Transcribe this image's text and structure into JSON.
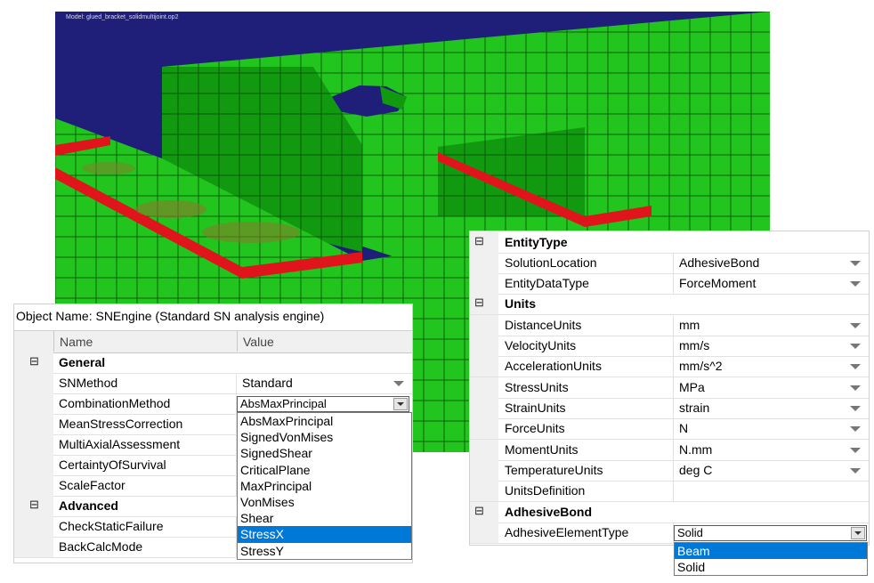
{
  "viewport": {
    "model_label": "Model:    glued_bracket_solidmultijoint.op2",
    "colors": {
      "background": "#1f1f7a",
      "mesh_green": "#22c41e",
      "mesh_dark": "#119910",
      "bond_red": "#e0141b",
      "mesh_line": "#0a4a08"
    }
  },
  "left_panel": {
    "object_name": "Object Name: SNEngine (Standard SN analysis engine)",
    "columns": {
      "name": "Name",
      "value": "Value"
    },
    "sections": [
      {
        "label": "General",
        "expander": "⊟",
        "properties": [
          {
            "name": "SNMethod",
            "value": "Standard",
            "dropdown": true
          },
          {
            "name": "CombinationMethod",
            "value": "AbsMaxPrincipal",
            "dropdown": true,
            "open": true
          },
          {
            "name": "MeanStressCorrection",
            "value": ""
          },
          {
            "name": "MultiAxialAssessment",
            "value": ""
          },
          {
            "name": "CertaintyOfSurvival",
            "value": ""
          },
          {
            "name": "ScaleFactor",
            "value": ""
          }
        ]
      },
      {
        "label": "Advanced",
        "expander": "⊟",
        "properties": [
          {
            "name": "CheckStaticFailure",
            "value": ""
          },
          {
            "name": "BackCalcMode",
            "value": ""
          }
        ]
      }
    ],
    "combination_options": [
      "AbsMaxPrincipal",
      "SignedVonMises",
      "SignedShear",
      "CriticalPlane",
      "MaxPrincipal",
      "VonMises",
      "Shear",
      "StressX",
      "StressY"
    ],
    "highlighted_option": "StressX"
  },
  "right_panel": {
    "sections": [
      {
        "label": "EntityType",
        "expander": "⊟",
        "properties": [
          {
            "name": "SolutionLocation",
            "value": "AdhesiveBond",
            "dropdown": true
          },
          {
            "name": "EntityDataType",
            "value": "ForceMoment",
            "dropdown": true
          }
        ]
      },
      {
        "label": "Units",
        "expander": "⊟",
        "properties": [
          {
            "name": "DistanceUnits",
            "value": "mm",
            "dropdown": true
          },
          {
            "name": "VelocityUnits",
            "value": "mm/s",
            "dropdown": true
          },
          {
            "name": "AccelerationUnits",
            "value": "mm/s^2",
            "dropdown": true
          },
          {
            "name": "StressUnits",
            "value": "MPa",
            "dropdown": true
          },
          {
            "name": "StrainUnits",
            "value": "strain",
            "dropdown": true
          },
          {
            "name": "ForceUnits",
            "value": "N",
            "dropdown": true
          },
          {
            "name": "MomentUnits",
            "value": "N.mm",
            "dropdown": true
          },
          {
            "name": "TemperatureUnits",
            "value": "deg C",
            "dropdown": true
          },
          {
            "name": "UnitsDefinition",
            "value": ""
          }
        ]
      },
      {
        "label": "AdhesiveBond",
        "expander": "⊟",
        "properties": [
          {
            "name": "AdhesiveElementType",
            "value": "Solid",
            "dropdown": true,
            "open": true
          }
        ]
      }
    ],
    "adhesive_options": [
      "Beam",
      "Solid"
    ],
    "highlighted_option": "Beam"
  }
}
